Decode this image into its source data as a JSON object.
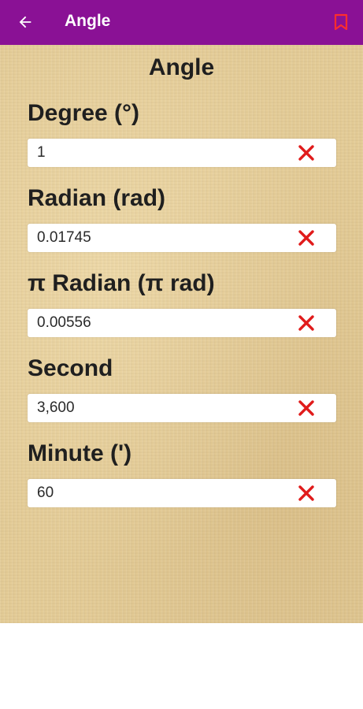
{
  "app_bar": {
    "title": "Angle",
    "back_icon": "arrow-left-icon",
    "bookmark_icon": "bookmark-icon",
    "background_color": "#8a1195",
    "bookmark_color": "#ff2d2d"
  },
  "page": {
    "heading": "Angle"
  },
  "fields": [
    {
      "label": "Degree (°)",
      "value": "1"
    },
    {
      "label": "Radian (rad)",
      "value": "0.01745"
    },
    {
      "label": "π Radian (π rad)",
      "value": "0.00556"
    },
    {
      "label": "Second",
      "value": "3,600"
    },
    {
      "label": "Minute (')",
      "value": "60"
    }
  ],
  "clear_icon": "close-x-icon",
  "clear_icon_color": "#e01b1b"
}
